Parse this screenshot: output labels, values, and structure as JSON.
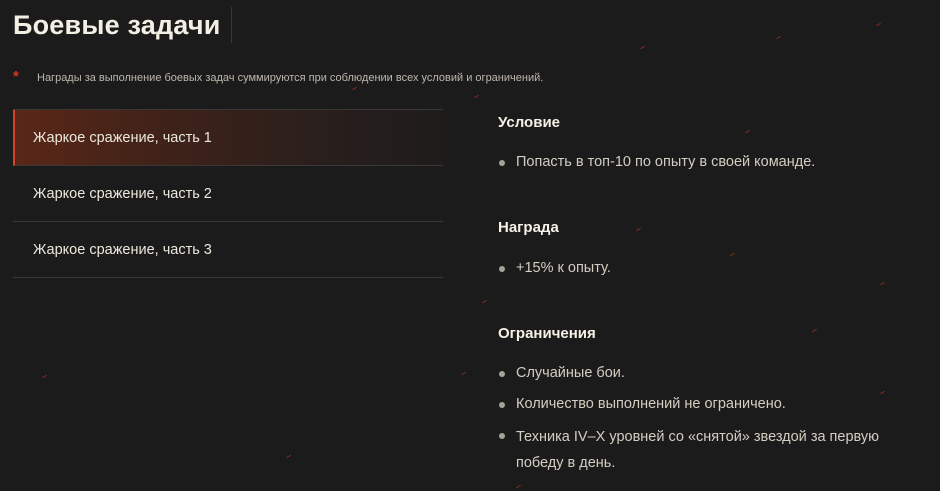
{
  "header": {
    "title": "Боевые задачи"
  },
  "note": {
    "asterisk": "*",
    "text": "Награды за выполнение боевых задач суммируются при соблюдении всех условий и ограничений."
  },
  "tasks": [
    {
      "label": "Жаркое сражение, часть 1",
      "active": true
    },
    {
      "label": "Жаркое сражение, часть 2",
      "active": false
    },
    {
      "label": "Жаркое сражение, часть 3",
      "active": false
    }
  ],
  "details": {
    "condition": {
      "title": "Условие",
      "items": [
        "Попасть в топ-10 по опыту в своей команде."
      ]
    },
    "reward": {
      "title": "Награда",
      "items": [
        "+15% к опыту."
      ]
    },
    "limits": {
      "title": "Ограничения",
      "items": [
        "Случайные бои.",
        "Количество выполнений не ограничено.",
        "Техника IV–X уровней со «снятой» звездой за первую победу в день."
      ]
    }
  },
  "colors": {
    "background": "#1c1b1b",
    "accent": "#d0452b",
    "asterisk": "#d83a24",
    "divider": "#3a3837"
  }
}
